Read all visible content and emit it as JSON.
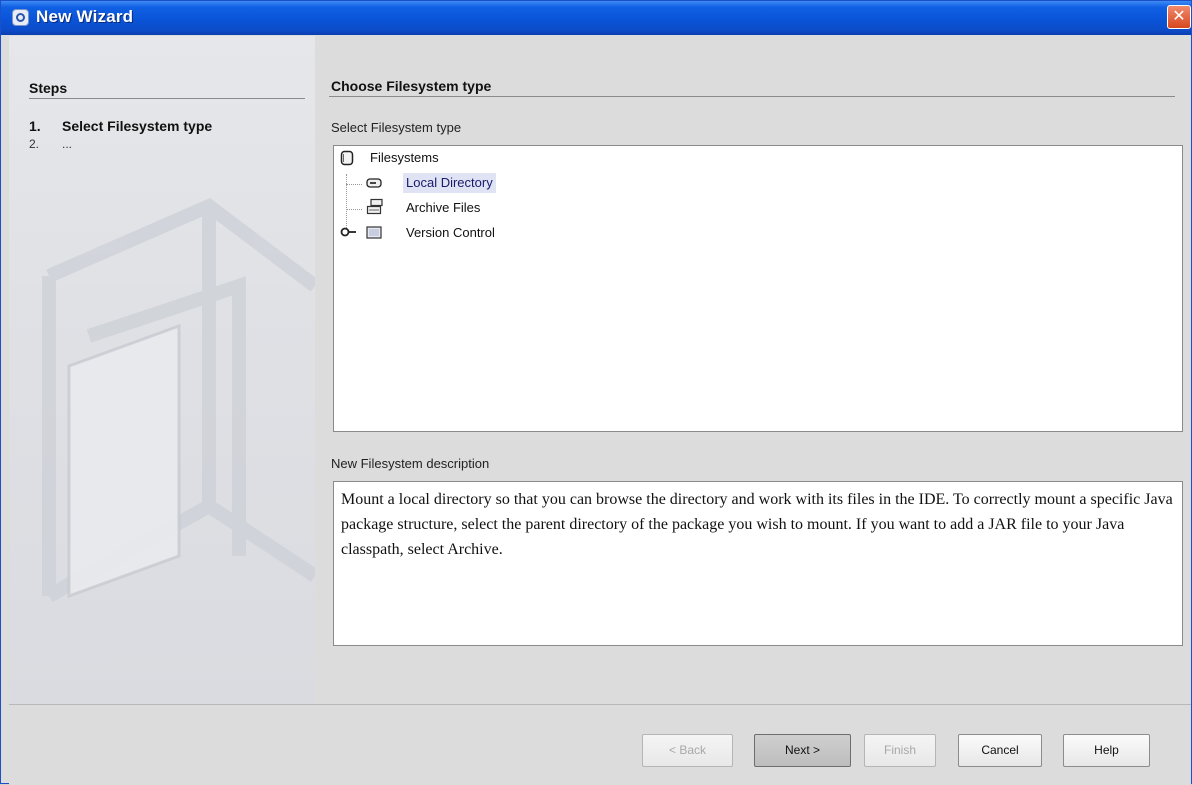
{
  "window": {
    "title": "New Wizard",
    "close_label": "✕"
  },
  "steps": {
    "heading": "Steps",
    "items": [
      {
        "number": "1.",
        "label": "Select Filesystem type"
      },
      {
        "number": "2.",
        "label": "..."
      }
    ]
  },
  "main": {
    "heading": "Choose Filesystem type",
    "select_label": "Select Filesystem type",
    "tree": {
      "root": "Filesystems",
      "children": [
        {
          "label": "Local Directory",
          "icon": "drive-icon",
          "selected": true
        },
        {
          "label": "Archive Files",
          "icon": "archive-icon",
          "selected": false
        },
        {
          "label": "Version Control",
          "icon": "folder-icon",
          "selected": false,
          "collapsed": true
        }
      ]
    },
    "description_label": "New Filesystem description",
    "description": "Mount a local directory so that you can browse the directory and work with its files in the IDE. To correctly mount a specific Java package structure, select the parent directory of the package you wish to mount. If you want to add a JAR file to your Java classpath, select Archive."
  },
  "buttons": {
    "back": "< Back",
    "next": "Next >",
    "finish": "Finish",
    "cancel": "Cancel",
    "help": "Help"
  },
  "colors": {
    "titlebar": "#0a54d8",
    "selection": "#dfe3f3",
    "close": "#d8471e"
  }
}
